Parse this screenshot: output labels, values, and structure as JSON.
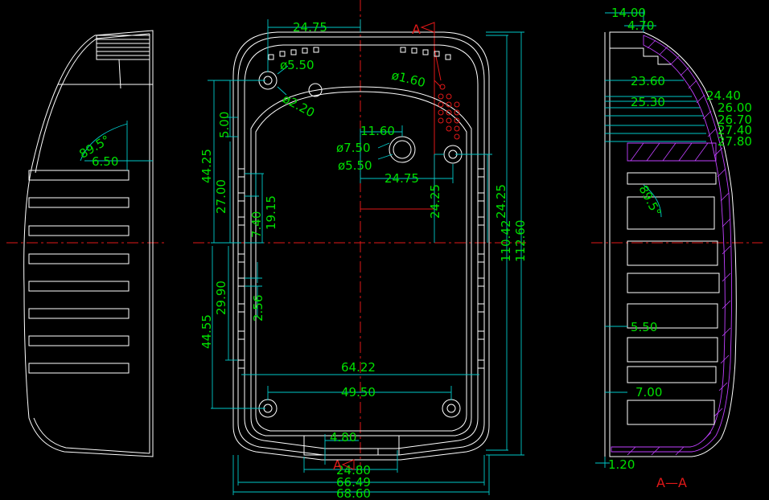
{
  "colors": {
    "background": "#000000",
    "outline": "#ffffff",
    "dimension_line": "#00c8c8",
    "dimension_text": "#00e000",
    "centerline": "#e01818",
    "hatch": "#c040ff"
  },
  "front_view": {
    "dims": {
      "top_width": "24.75",
      "hole_large": "ø5.50",
      "hole_small": "ø2.20",
      "grille_hole": "ø1.60",
      "top_offset": "5.00",
      "upper_half": "44.25",
      "rib_zone_upper": "27.00",
      "rib_pitch": "7.40",
      "rib_span": "19.15",
      "button_width": "11.60",
      "button_outer": "ø7.50",
      "button_inner": "ø5.50",
      "button_offset": "24.75",
      "hole_depth": "24.25",
      "hole_depth_right": "24.25",
      "height_inner": "110.42",
      "height_outer": "112.60",
      "rib_zone_lower": "29.90",
      "rib_gap": "2.56",
      "lower_half": "44.55",
      "width_inner": "64.22",
      "lower_hole_spacing": "49.50",
      "slot_width": "4.80",
      "bottom_width_a": "24.80",
      "bottom_width_b": "66.49",
      "overall_width": "68.60"
    },
    "section_marker_top": "A",
    "section_marker_bottom": "A"
  },
  "left_view": {
    "dims": {
      "draft_angle": "89.5°",
      "rib_depth": "6.50"
    }
  },
  "section_view": {
    "dims": {
      "depth_total": "14.00",
      "wall": "4.70",
      "step_1": "23.60",
      "step_2": "24.40",
      "step_3": "25.30",
      "step_4": "26.00",
      "step_5": "26.70",
      "step_6": "27.40",
      "step_7": "27.80",
      "draft_angle": "89.5°",
      "rib_inset": "5.50",
      "rib_length": "7.00",
      "bottom_wall": "1.20"
    },
    "label": "A—A"
  }
}
